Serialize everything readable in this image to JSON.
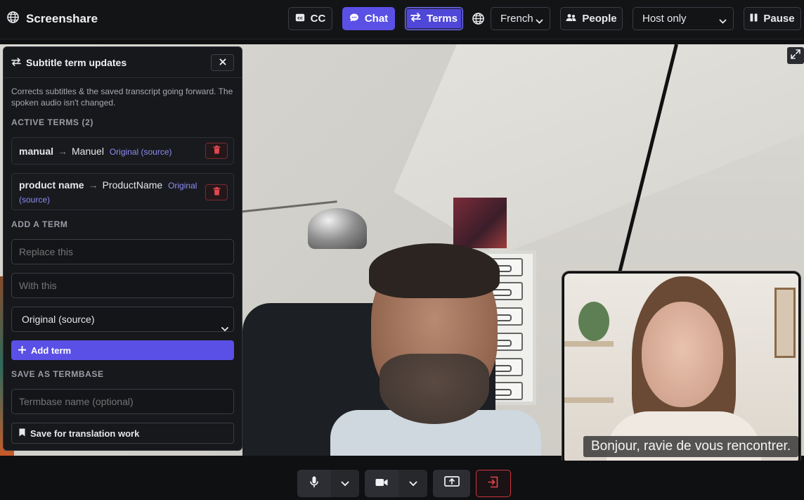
{
  "app": {
    "title": "Screenshare"
  },
  "toolbar": {
    "cc_label": "CC",
    "chat_label": "Chat",
    "terms_label": "Terms",
    "language_value": "French",
    "people_label": "People",
    "audience_value": "Host only",
    "pause_label": "Pause"
  },
  "panel": {
    "title": "Subtitle term updates",
    "description": "Corrects subtitles & the saved transcript going forward. The spoken audio isn't changed.",
    "active_terms_label": "ACTIVE TERMS (2)",
    "terms": [
      {
        "source": "manual",
        "target": "Manuel",
        "scope": "Original (source)"
      },
      {
        "source": "product name",
        "target": "ProductName",
        "scope_line1": "Original",
        "scope_line2": "(source)"
      }
    ],
    "add_term_label": "ADD A TERM",
    "replace_placeholder": "Replace this",
    "with_placeholder": "With this",
    "scope_select_value": "Original (source)",
    "add_button_label": "Add term",
    "save_section_label": "SAVE AS TERMBASE",
    "termbase_placeholder": "Termbase name (optional)",
    "save_button_label": "Save for translation work"
  },
  "pip": {
    "caption": "Bonjour, ravie de vous rencontrer."
  },
  "colors": {
    "accent": "#5a50e6",
    "danger": "#d0333e",
    "background": "#0f1012"
  }
}
